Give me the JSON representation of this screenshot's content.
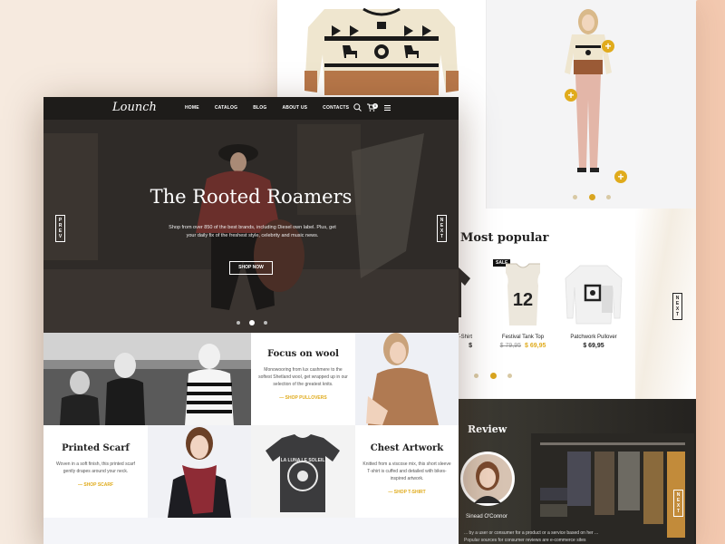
{
  "brand": {
    "logo": "Lounch"
  },
  "nav": {
    "items": [
      "HOME",
      "CATALOG",
      "BLOG",
      "ABOUT US",
      "CONTACTS"
    ],
    "cart_count": "0"
  },
  "hero": {
    "title": "The Rooted Roamers",
    "subtitle": "Shop from over 850 of the best brands, including Diesel own label. Plus, get your daily fix of the freshest style, celebrity and music news.",
    "button": "SHOP NOW",
    "prev": "PREV",
    "next": "NEXT"
  },
  "features": [
    {
      "title": "Focus on wool",
      "text": "Monowooring from lux cashmere to the softest Shetland wool, get wrapped up in our selection of the greatest knits.",
      "link": "SHOP PULLOVERS"
    },
    {
      "title": "Printed Scarf",
      "text": "Woven in a soft finish, this printed scarf gently drapes around your neck.",
      "link": "SHOP SCARF"
    },
    {
      "title": "Chest Artwork",
      "text": "Knitted from a viscose mix, this short sleeve T-shirt is cuffed and detailed with bikes-inspired artwork.",
      "link": "SHOP T-SHIRT"
    }
  ],
  "tshirt_print": "LA LUNA LE SOLEIL",
  "most_popular": {
    "title": "Most popular",
    "sale_badge": "SALE",
    "next": "NEXT",
    "products": [
      {
        "name": "Festival Tank Top",
        "old_price": "$ 79,95",
        "price": "$ 69,95",
        "number": "12"
      },
      {
        "name": "Patchwork Pullover",
        "price": "$ 69,95"
      }
    ],
    "partial_product": {
      "name": "T-Shirt",
      "price": "$"
    }
  },
  "review": {
    "title": "Review",
    "author": "Sinead O'Connor",
    "text": "... by a user or consumer for a product or a service based on her ... Popular sources for consumer reviews are e-commerce sites",
    "next": "NEXT"
  },
  "colors": {
    "accent": "#e0ab1c",
    "dark": "#222222",
    "peach": "#f3c9b0"
  }
}
